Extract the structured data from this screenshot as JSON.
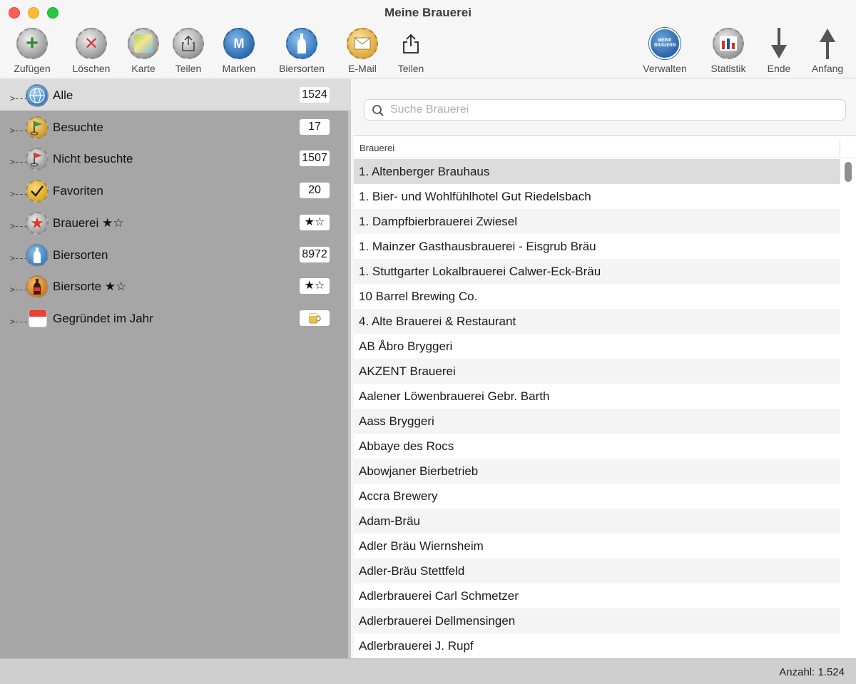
{
  "window": {
    "title": "Meine Brauerei"
  },
  "toolbar": {
    "left": [
      {
        "label": "Zufügen",
        "icon": "add-icon"
      },
      {
        "label": "Löschen",
        "icon": "delete-icon"
      },
      {
        "label": "Karte",
        "icon": "map-icon"
      },
      {
        "label": "Teilen",
        "icon": "share-icon"
      },
      {
        "label": "Marken",
        "icon": "brand-icon"
      },
      {
        "label": "Biersorten",
        "icon": "bottle-icon"
      },
      {
        "label": "E-Mail",
        "icon": "mail-icon"
      },
      {
        "label": "Teilen",
        "icon": "share-icon"
      }
    ],
    "right": [
      {
        "label": "Verwalten",
        "icon": "manage-icon",
        "badge_text": "MEINE BRAUEREI"
      },
      {
        "label": "Statistik",
        "icon": "statistics-icon"
      },
      {
        "label": "Ende",
        "icon": "arrow-down-icon"
      },
      {
        "label": "Anfang",
        "icon": "arrow-up-icon"
      }
    ]
  },
  "sidebar": {
    "items": [
      {
        "label": "Alle",
        "badge": "1524",
        "icon": "globe-icon",
        "selected": true
      },
      {
        "label": "Besuchte",
        "badge": "17",
        "icon": "visited-flag-icon"
      },
      {
        "label": "Nicht besuchte",
        "badge": "1507",
        "icon": "not-visited-flag-icon"
      },
      {
        "label": "Favoriten",
        "badge": "20",
        "icon": "checkmark-icon"
      },
      {
        "label": "Brauerei ★☆",
        "badge": "★☆",
        "icon": "star-icon"
      },
      {
        "label": "Biersorten",
        "badge": "8972",
        "icon": "bottle-icon"
      },
      {
        "label": "Biersorte ★☆",
        "badge": "★☆",
        "icon": "beer-bottle-icon"
      },
      {
        "label": "Gegründet im Jahr",
        "badge": "",
        "icon": "calendar-icon"
      }
    ]
  },
  "search": {
    "placeholder": "Suche Brauerei",
    "value": ""
  },
  "table": {
    "column": "Brauerei",
    "rows": [
      "1. Altenberger Brauhaus",
      "1. Bier- und Wohlfühlhotel Gut Riedelsbach",
      "1. Dampfbierbrauerei Zwiesel",
      "1. Mainzer Gasthausbrauerei - Eisgrub Bräu",
      "1. Stuttgarter Lokalbrauerei Calwer-Eck-Bräu",
      "10 Barrel Brewing Co.",
      "4. Alte Brauerei & Restaurant",
      "AB Åbro Bryggeri",
      "AKZENT Brauerei",
      "Aalener Löwenbrauerei Gebr. Barth",
      "Aass Bryggeri",
      "Abbaye des Rocs",
      "Abowjaner Bierbetrieb",
      "Accra Brewery",
      "Adam-Bräu",
      "Adler Bräu Wiernsheim",
      "Adler-Bräu Stettfeld",
      "Adlerbrauerei Carl Schmetzer",
      "Adlerbrauerei Dellmensingen",
      "Adlerbrauerei J. Rupf"
    ]
  },
  "status": {
    "text": "Anzahl: 1.524"
  }
}
